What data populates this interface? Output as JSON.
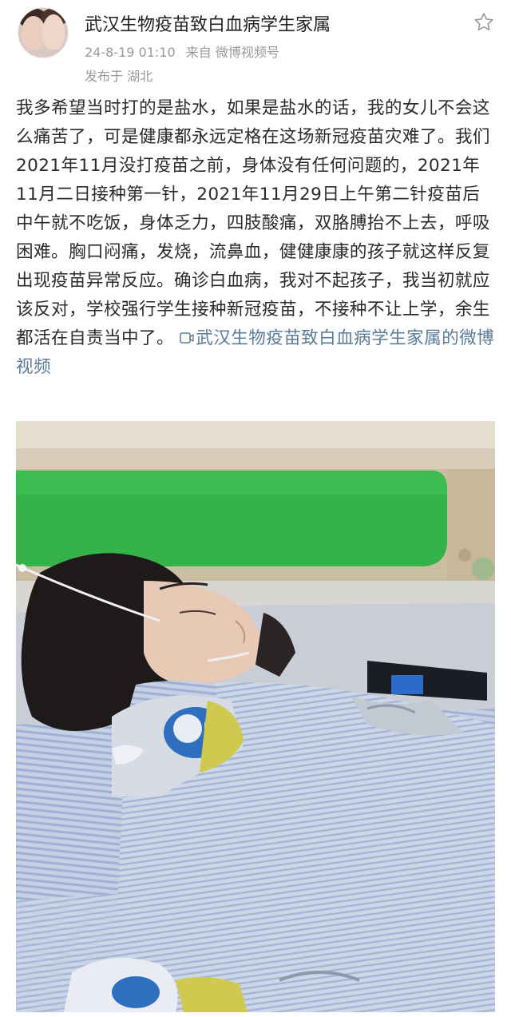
{
  "post": {
    "author": "武汉生物疫苗致白血病学生家属",
    "date": "24-8-19 01:10",
    "source": "来自 微博视频号",
    "location": "发布于 湖北",
    "body_text": "我多希望当时打的是盐水，如果是盐水的话，我的女儿不会这么痛苦了，可是健康都永远定格在这场新冠疫苗灾难了。我们2021年11月没打疫苗之前，身体没有任何问题的，2021年11月二日接种第一针，2021年11月29日上午第二针疫苗后中午就不吃饭，身体乏力，四肢酸痛，双胳膊抬不上去，呼吸困难。胸口闷痛，发烧，流鼻血，健健康康的孩子就这样反复出现疫苗异常反应。确诊白血病，我对不起孩子，我当初就应该反对，学校强行学生接种新冠疫苗，不接种不让上学，余生都活在自责当中了。",
    "video_link": "武汉生物疫苗致白血病学生家属的微博视频"
  },
  "icons": {
    "favorite": "star-outline-icon",
    "video": "video-play-icon"
  },
  "colors": {
    "link": "#5b7b9a",
    "meta": "#9a9a9a",
    "text": "#2b2b2b"
  }
}
